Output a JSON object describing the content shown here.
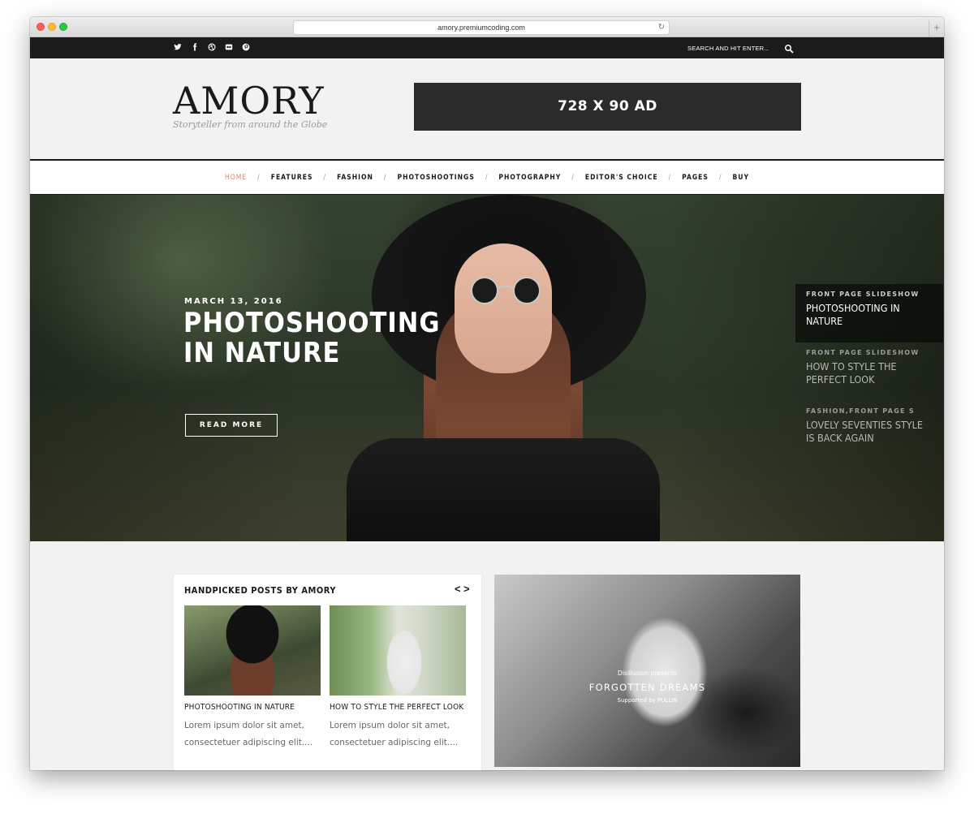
{
  "browser": {
    "url": "amory.premiumcoding.com"
  },
  "topbar": {
    "social_icons": [
      "twitter-icon",
      "facebook-icon",
      "dribbble-icon",
      "flickr-icon",
      "pinterest-icon"
    ],
    "search_placeholder": "SEARCH AND HIT ENTER..."
  },
  "header": {
    "logo": "AMORY",
    "tagline": "Storyteller from around the Globe",
    "ad_label": "728 X 90 AD"
  },
  "nav": {
    "items": [
      {
        "label": "HOME",
        "active": true
      },
      {
        "label": "FEATURES"
      },
      {
        "label": "FASHION"
      },
      {
        "label": "PHOTOSHOOTINGS"
      },
      {
        "label": "PHOTOGRAPHY"
      },
      {
        "label": "EDITOR'S CHOICE"
      },
      {
        "label": "PAGES"
      },
      {
        "label": "BUY"
      }
    ],
    "separator": "/"
  },
  "hero": {
    "date": "MARCH 13, 2016",
    "title": "PHOTOSHOOTING IN NATURE",
    "button": "READ MORE",
    "slides": [
      {
        "category": "FRONT PAGE SLIDESHOW",
        "title": "PHOTOSHOOTING IN NATURE"
      },
      {
        "category": "FRONT PAGE SLIDESHOW",
        "title": "HOW TO STYLE THE PERFECT LOOK"
      },
      {
        "category": "FASHION,FRONT PAGE S",
        "title": "LOVELY SEVENTIES STYLE IS BACK AGAIN"
      }
    ]
  },
  "handpicked": {
    "title": "HANDPICKED POSTS BY AMORY",
    "prev": "<",
    "next": ">",
    "posts": [
      {
        "title": "PHOTOSHOOTING IN NATURE",
        "excerpt": "Lorem ipsum dolor sit amet, consectetuer adipiscing elit...."
      },
      {
        "title": "HOW TO STYLE THE PERFECT LOOK",
        "excerpt": "Lorem ipsum dolor sit amet, consectetuer adipiscing elit...."
      }
    ]
  },
  "promo": {
    "presents": "Disillusion presents",
    "title": "FORGOTTEN DREAMS",
    "supported": "Supported by PULLIN"
  },
  "colors": {
    "accent": "#e8825f",
    "topbar": "#1b1b1b",
    "ad": "#2b2b2b"
  }
}
